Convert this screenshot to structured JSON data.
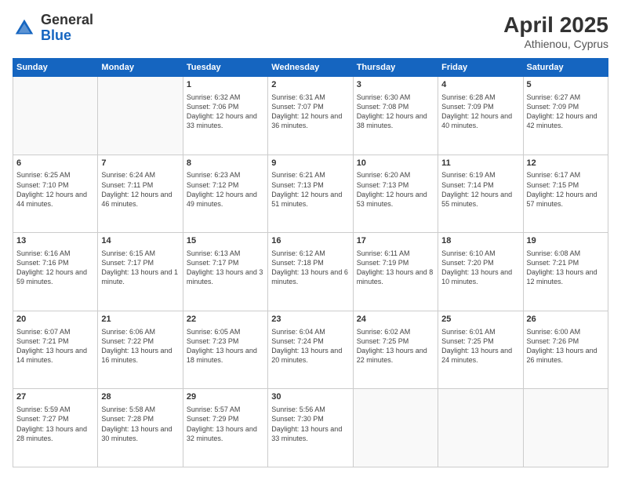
{
  "logo": {
    "general": "General",
    "blue": "Blue"
  },
  "header": {
    "month": "April 2025",
    "location": "Athienou, Cyprus"
  },
  "weekdays": [
    "Sunday",
    "Monday",
    "Tuesday",
    "Wednesday",
    "Thursday",
    "Friday",
    "Saturday"
  ],
  "weeks": [
    [
      {
        "day": "",
        "empty": true
      },
      {
        "day": "",
        "empty": true
      },
      {
        "day": "1",
        "sunrise": "Sunrise: 6:32 AM",
        "sunset": "Sunset: 7:06 PM",
        "daylight": "Daylight: 12 hours and 33 minutes."
      },
      {
        "day": "2",
        "sunrise": "Sunrise: 6:31 AM",
        "sunset": "Sunset: 7:07 PM",
        "daylight": "Daylight: 12 hours and 36 minutes."
      },
      {
        "day": "3",
        "sunrise": "Sunrise: 6:30 AM",
        "sunset": "Sunset: 7:08 PM",
        "daylight": "Daylight: 12 hours and 38 minutes."
      },
      {
        "day": "4",
        "sunrise": "Sunrise: 6:28 AM",
        "sunset": "Sunset: 7:09 PM",
        "daylight": "Daylight: 12 hours and 40 minutes."
      },
      {
        "day": "5",
        "sunrise": "Sunrise: 6:27 AM",
        "sunset": "Sunset: 7:09 PM",
        "daylight": "Daylight: 12 hours and 42 minutes."
      }
    ],
    [
      {
        "day": "6",
        "sunrise": "Sunrise: 6:25 AM",
        "sunset": "Sunset: 7:10 PM",
        "daylight": "Daylight: 12 hours and 44 minutes."
      },
      {
        "day": "7",
        "sunrise": "Sunrise: 6:24 AM",
        "sunset": "Sunset: 7:11 PM",
        "daylight": "Daylight: 12 hours and 46 minutes."
      },
      {
        "day": "8",
        "sunrise": "Sunrise: 6:23 AM",
        "sunset": "Sunset: 7:12 PM",
        "daylight": "Daylight: 12 hours and 49 minutes."
      },
      {
        "day": "9",
        "sunrise": "Sunrise: 6:21 AM",
        "sunset": "Sunset: 7:13 PM",
        "daylight": "Daylight: 12 hours and 51 minutes."
      },
      {
        "day": "10",
        "sunrise": "Sunrise: 6:20 AM",
        "sunset": "Sunset: 7:13 PM",
        "daylight": "Daylight: 12 hours and 53 minutes."
      },
      {
        "day": "11",
        "sunrise": "Sunrise: 6:19 AM",
        "sunset": "Sunset: 7:14 PM",
        "daylight": "Daylight: 12 hours and 55 minutes."
      },
      {
        "day": "12",
        "sunrise": "Sunrise: 6:17 AM",
        "sunset": "Sunset: 7:15 PM",
        "daylight": "Daylight: 12 hours and 57 minutes."
      }
    ],
    [
      {
        "day": "13",
        "sunrise": "Sunrise: 6:16 AM",
        "sunset": "Sunset: 7:16 PM",
        "daylight": "Daylight: 12 hours and 59 minutes."
      },
      {
        "day": "14",
        "sunrise": "Sunrise: 6:15 AM",
        "sunset": "Sunset: 7:17 PM",
        "daylight": "Daylight: 13 hours and 1 minute."
      },
      {
        "day": "15",
        "sunrise": "Sunrise: 6:13 AM",
        "sunset": "Sunset: 7:17 PM",
        "daylight": "Daylight: 13 hours and 3 minutes."
      },
      {
        "day": "16",
        "sunrise": "Sunrise: 6:12 AM",
        "sunset": "Sunset: 7:18 PM",
        "daylight": "Daylight: 13 hours and 6 minutes."
      },
      {
        "day": "17",
        "sunrise": "Sunrise: 6:11 AM",
        "sunset": "Sunset: 7:19 PM",
        "daylight": "Daylight: 13 hours and 8 minutes."
      },
      {
        "day": "18",
        "sunrise": "Sunrise: 6:10 AM",
        "sunset": "Sunset: 7:20 PM",
        "daylight": "Daylight: 13 hours and 10 minutes."
      },
      {
        "day": "19",
        "sunrise": "Sunrise: 6:08 AM",
        "sunset": "Sunset: 7:21 PM",
        "daylight": "Daylight: 13 hours and 12 minutes."
      }
    ],
    [
      {
        "day": "20",
        "sunrise": "Sunrise: 6:07 AM",
        "sunset": "Sunset: 7:21 PM",
        "daylight": "Daylight: 13 hours and 14 minutes."
      },
      {
        "day": "21",
        "sunrise": "Sunrise: 6:06 AM",
        "sunset": "Sunset: 7:22 PM",
        "daylight": "Daylight: 13 hours and 16 minutes."
      },
      {
        "day": "22",
        "sunrise": "Sunrise: 6:05 AM",
        "sunset": "Sunset: 7:23 PM",
        "daylight": "Daylight: 13 hours and 18 minutes."
      },
      {
        "day": "23",
        "sunrise": "Sunrise: 6:04 AM",
        "sunset": "Sunset: 7:24 PM",
        "daylight": "Daylight: 13 hours and 20 minutes."
      },
      {
        "day": "24",
        "sunrise": "Sunrise: 6:02 AM",
        "sunset": "Sunset: 7:25 PM",
        "daylight": "Daylight: 13 hours and 22 minutes."
      },
      {
        "day": "25",
        "sunrise": "Sunrise: 6:01 AM",
        "sunset": "Sunset: 7:25 PM",
        "daylight": "Daylight: 13 hours and 24 minutes."
      },
      {
        "day": "26",
        "sunrise": "Sunrise: 6:00 AM",
        "sunset": "Sunset: 7:26 PM",
        "daylight": "Daylight: 13 hours and 26 minutes."
      }
    ],
    [
      {
        "day": "27",
        "sunrise": "Sunrise: 5:59 AM",
        "sunset": "Sunset: 7:27 PM",
        "daylight": "Daylight: 13 hours and 28 minutes."
      },
      {
        "day": "28",
        "sunrise": "Sunrise: 5:58 AM",
        "sunset": "Sunset: 7:28 PM",
        "daylight": "Daylight: 13 hours and 30 minutes."
      },
      {
        "day": "29",
        "sunrise": "Sunrise: 5:57 AM",
        "sunset": "Sunset: 7:29 PM",
        "daylight": "Daylight: 13 hours and 32 minutes."
      },
      {
        "day": "30",
        "sunrise": "Sunrise: 5:56 AM",
        "sunset": "Sunset: 7:30 PM",
        "daylight": "Daylight: 13 hours and 33 minutes."
      },
      {
        "day": "",
        "empty": true
      },
      {
        "day": "",
        "empty": true
      },
      {
        "day": "",
        "empty": true
      }
    ]
  ]
}
